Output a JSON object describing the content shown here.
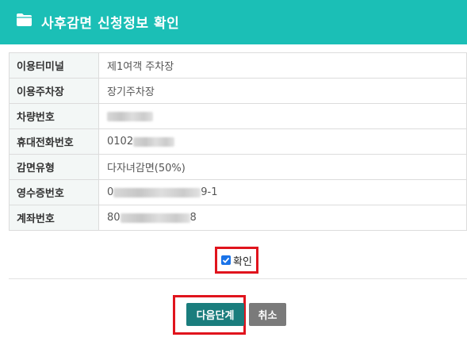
{
  "header": {
    "title": "사후감면 신청정보 확인",
    "icon": "folder-icon",
    "color": "#1bbfb6"
  },
  "info": {
    "rows": [
      {
        "label": "이용터미널",
        "value": "제1여객 주차장"
      },
      {
        "label": "이용주차장",
        "value": "장기주차장"
      },
      {
        "label": "차량번호",
        "value": ""
      },
      {
        "label": "휴대전화번호",
        "value": "0102"
      },
      {
        "label": "감면유형",
        "value": "다자녀감면(50%)"
      },
      {
        "label": "영수증번호",
        "value": "0",
        "suffix": "9-1"
      },
      {
        "label": "계좌번호",
        "value": "80",
        "suffix": "8"
      }
    ]
  },
  "confirm": {
    "label": "확인",
    "checked": true
  },
  "buttons": {
    "next": "다음단계",
    "cancel": "취소"
  },
  "colors": {
    "accent": "#1bbfb6",
    "next_button": "#1a7d7d",
    "cancel_button": "#7a7a7a",
    "highlight": "#e0141d"
  }
}
